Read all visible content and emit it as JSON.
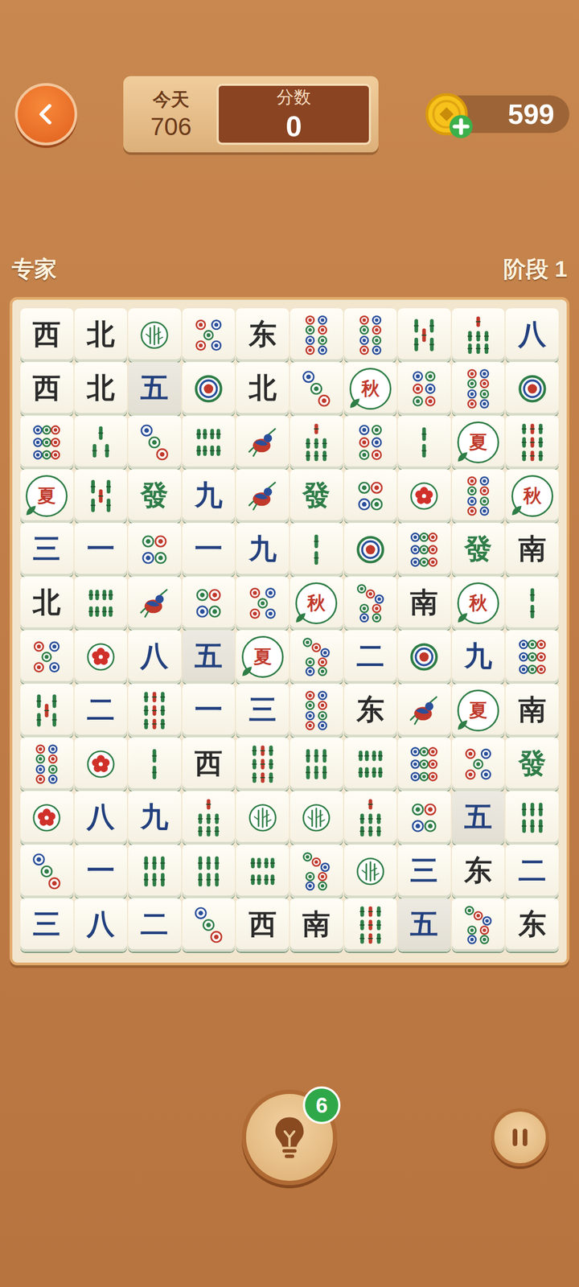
{
  "header": {
    "today": {
      "label": "今天",
      "value": "706"
    },
    "score": {
      "label": "分数",
      "value": "0"
    },
    "coins": {
      "value": "599"
    }
  },
  "difficulty": "专家",
  "stage": "阶段 1",
  "board": {
    "rows": [
      [
        {
          "kind": "char",
          "text": "西",
          "color": "#2b2b2b",
          "shaded": false
        },
        {
          "kind": "char",
          "text": "北",
          "color": "#2b2b2b",
          "shaded": false
        },
        {
          "kind": "orchid",
          "shaded": false
        },
        {
          "kind": "dots",
          "count": 5,
          "shaded": false
        },
        {
          "kind": "char",
          "text": "东",
          "color": "#2b2b2b",
          "shaded": false
        },
        {
          "kind": "dots",
          "count": 8,
          "shaded": false
        },
        {
          "kind": "dots",
          "count": 8,
          "shaded": false
        },
        {
          "kind": "bamboo",
          "count": 5,
          "shaded": false
        },
        {
          "kind": "bamboo",
          "count": 7,
          "shaded": false
        },
        {
          "kind": "char",
          "text": "八",
          "color": "#22407e",
          "shaded": false
        }
      ],
      [
        {
          "kind": "char",
          "text": "西",
          "color": "#2b2b2b",
          "shaded": false
        },
        {
          "kind": "char",
          "text": "北",
          "color": "#2b2b2b",
          "shaded": false
        },
        {
          "kind": "char",
          "text": "五",
          "color": "#22407e",
          "shaded": true
        },
        {
          "kind": "dots",
          "count": 1,
          "shaded": false
        },
        {
          "kind": "char",
          "text": "北",
          "color": "#2b2b2b",
          "shaded": false
        },
        {
          "kind": "dots",
          "count": 3,
          "shaded": false
        },
        {
          "kind": "season",
          "text": "秋",
          "shaded": false
        },
        {
          "kind": "dots",
          "count": 6,
          "shaded": false
        },
        {
          "kind": "dots",
          "count": 8,
          "shaded": false
        },
        {
          "kind": "dots",
          "count": 1,
          "shaded": false
        }
      ],
      [
        {
          "kind": "dots",
          "count": 9,
          "shaded": false
        },
        {
          "kind": "bamboo",
          "count": 3,
          "shaded": false
        },
        {
          "kind": "dots",
          "count": 3,
          "shaded": false
        },
        {
          "kind": "bamboo",
          "count": 8,
          "shaded": false
        },
        {
          "kind": "bird",
          "shaded": false
        },
        {
          "kind": "bamboo",
          "count": 7,
          "shaded": false
        },
        {
          "kind": "dots",
          "count": 6,
          "shaded": false
        },
        {
          "kind": "bamboo",
          "count": 2,
          "shaded": false
        },
        {
          "kind": "season",
          "text": "夏",
          "shaded": false
        },
        {
          "kind": "bamboo",
          "count": 9,
          "shaded": false
        }
      ],
      [
        {
          "kind": "season",
          "text": "夏",
          "shaded": false
        },
        {
          "kind": "bamboo",
          "count": 5,
          "shaded": false
        },
        {
          "kind": "char",
          "text": "發",
          "color": "#2f7d48",
          "shaded": false
        },
        {
          "kind": "char",
          "text": "九",
          "color": "#22407e",
          "shaded": false
        },
        {
          "kind": "bird",
          "shaded": false
        },
        {
          "kind": "char",
          "text": "發",
          "color": "#2f7d48",
          "shaded": false
        },
        {
          "kind": "dots",
          "count": 4,
          "shaded": false
        },
        {
          "kind": "plum",
          "shaded": false
        },
        {
          "kind": "dots",
          "count": 8,
          "shaded": false
        },
        {
          "kind": "season",
          "text": "秋",
          "shaded": false
        }
      ],
      [
        {
          "kind": "char",
          "text": "三",
          "color": "#22407e",
          "shaded": false
        },
        {
          "kind": "char",
          "text": "一",
          "color": "#22407e",
          "shaded": false
        },
        {
          "kind": "dots",
          "count": 4,
          "shaded": false
        },
        {
          "kind": "char",
          "text": "一",
          "color": "#22407e",
          "shaded": false
        },
        {
          "kind": "char",
          "text": "九",
          "color": "#22407e",
          "shaded": false
        },
        {
          "kind": "bamboo",
          "count": 2,
          "shaded": false
        },
        {
          "kind": "dots",
          "count": 1,
          "shaded": false
        },
        {
          "kind": "dots",
          "count": 9,
          "shaded": false
        },
        {
          "kind": "char",
          "text": "發",
          "color": "#2f7d48",
          "shaded": false
        },
        {
          "kind": "char",
          "text": "南",
          "color": "#2b2b2b",
          "shaded": false
        }
      ],
      [
        {
          "kind": "char",
          "text": "北",
          "color": "#2b2b2b",
          "shaded": false
        },
        {
          "kind": "bamboo",
          "count": 8,
          "shaded": false
        },
        {
          "kind": "bird",
          "shaded": false
        },
        {
          "kind": "dots",
          "count": 4,
          "shaded": false
        },
        {
          "kind": "dots",
          "count": 5,
          "shaded": false
        },
        {
          "kind": "season",
          "text": "秋",
          "shaded": false
        },
        {
          "kind": "dots",
          "count": 7,
          "shaded": false
        },
        {
          "kind": "char",
          "text": "南",
          "color": "#2b2b2b",
          "shaded": false
        },
        {
          "kind": "season",
          "text": "秋",
          "shaded": false
        },
        {
          "kind": "bamboo",
          "count": 2,
          "shaded": false
        }
      ],
      [
        {
          "kind": "dots",
          "count": 5,
          "shaded": false
        },
        {
          "kind": "plum",
          "shaded": false
        },
        {
          "kind": "char",
          "text": "八",
          "color": "#22407e",
          "shaded": false
        },
        {
          "kind": "char",
          "text": "五",
          "color": "#22407e",
          "shaded": true
        },
        {
          "kind": "season",
          "text": "夏",
          "shaded": false
        },
        {
          "kind": "dots",
          "count": 7,
          "shaded": false
        },
        {
          "kind": "char",
          "text": "二",
          "color": "#22407e",
          "shaded": false
        },
        {
          "kind": "dots",
          "count": 1,
          "shaded": false
        },
        {
          "kind": "char",
          "text": "九",
          "color": "#22407e",
          "shaded": false
        },
        {
          "kind": "dots",
          "count": 9,
          "shaded": false
        }
      ],
      [
        {
          "kind": "bamboo",
          "count": 5,
          "shaded": false
        },
        {
          "kind": "char",
          "text": "二",
          "color": "#22407e",
          "shaded": false
        },
        {
          "kind": "bamboo",
          "count": 9,
          "shaded": false
        },
        {
          "kind": "char",
          "text": "一",
          "color": "#22407e",
          "shaded": false
        },
        {
          "kind": "char",
          "text": "三",
          "color": "#22407e",
          "shaded": false
        },
        {
          "kind": "dots",
          "count": 8,
          "shaded": false
        },
        {
          "kind": "char",
          "text": "东",
          "color": "#2b2b2b",
          "shaded": false
        },
        {
          "kind": "bird",
          "shaded": false
        },
        {
          "kind": "season",
          "text": "夏",
          "shaded": false
        },
        {
          "kind": "char",
          "text": "南",
          "color": "#2b2b2b",
          "shaded": false
        }
      ],
      [
        {
          "kind": "dots",
          "count": 8,
          "shaded": false
        },
        {
          "kind": "plum",
          "shaded": false
        },
        {
          "kind": "bamboo",
          "count": 2,
          "shaded": false
        },
        {
          "kind": "char",
          "text": "西",
          "color": "#2b2b2b",
          "shaded": false
        },
        {
          "kind": "bamboo",
          "count": 9,
          "shaded": false
        },
        {
          "kind": "bamboo",
          "count": 6,
          "shaded": false
        },
        {
          "kind": "bamboo",
          "count": 8,
          "shaded": false
        },
        {
          "kind": "dots",
          "count": 9,
          "shaded": false
        },
        {
          "kind": "dots",
          "count": 5,
          "shaded": false
        },
        {
          "kind": "char",
          "text": "發",
          "color": "#2f7d48",
          "shaded": false
        }
      ],
      [
        {
          "kind": "plum",
          "shaded": false
        },
        {
          "kind": "char",
          "text": "八",
          "color": "#22407e",
          "shaded": false
        },
        {
          "kind": "char",
          "text": "九",
          "color": "#22407e",
          "shaded": false
        },
        {
          "kind": "bamboo",
          "count": 7,
          "shaded": false
        },
        {
          "kind": "orchid",
          "shaded": false
        },
        {
          "kind": "orchid",
          "shaded": false
        },
        {
          "kind": "bamboo",
          "count": 7,
          "shaded": false
        },
        {
          "kind": "dots",
          "count": 4,
          "shaded": false
        },
        {
          "kind": "char",
          "text": "五",
          "color": "#22407e",
          "shaded": true
        },
        {
          "kind": "bamboo",
          "count": 6,
          "shaded": false
        }
      ],
      [
        {
          "kind": "dots",
          "count": 3,
          "shaded": false
        },
        {
          "kind": "char",
          "text": "一",
          "color": "#22407e",
          "shaded": false
        },
        {
          "kind": "bamboo",
          "count": 6,
          "shaded": false
        },
        {
          "kind": "bamboo",
          "count": 6,
          "shaded": false
        },
        {
          "kind": "bamboo",
          "count": 8,
          "shaded": false
        },
        {
          "kind": "dots",
          "count": 7,
          "shaded": false
        },
        {
          "kind": "orchid",
          "shaded": false
        },
        {
          "kind": "char",
          "text": "三",
          "color": "#22407e",
          "shaded": false
        },
        {
          "kind": "char",
          "text": "东",
          "color": "#2b2b2b",
          "shaded": false
        },
        {
          "kind": "char",
          "text": "二",
          "color": "#22407e",
          "shaded": false
        }
      ],
      [
        {
          "kind": "char",
          "text": "三",
          "color": "#22407e",
          "shaded": false
        },
        {
          "kind": "char",
          "text": "八",
          "color": "#22407e",
          "shaded": false
        },
        {
          "kind": "char",
          "text": "二",
          "color": "#22407e",
          "shaded": false
        },
        {
          "kind": "dots",
          "count": 3,
          "shaded": false
        },
        {
          "kind": "char",
          "text": "西",
          "color": "#2b2b2b",
          "shaded": false
        },
        {
          "kind": "char",
          "text": "南",
          "color": "#2b2b2b",
          "shaded": false
        },
        {
          "kind": "bamboo",
          "count": 9,
          "shaded": false
        },
        {
          "kind": "char",
          "text": "五",
          "color": "#22407e",
          "shaded": true
        },
        {
          "kind": "dots",
          "count": 7,
          "shaded": false
        },
        {
          "kind": "char",
          "text": "东",
          "color": "#2b2b2b",
          "shaded": false
        }
      ]
    ]
  },
  "hint": {
    "badge": "6"
  }
}
